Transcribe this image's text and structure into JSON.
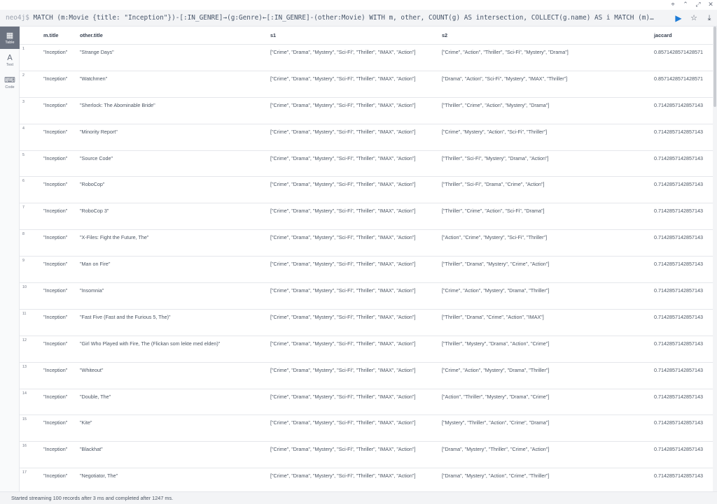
{
  "window_controls": [
    "⌖",
    "⌃",
    "⤢",
    "✕"
  ],
  "query": {
    "prompt": "neo4j$",
    "text": " MATCH (m:Movie {title: \"Inception\"})-[:IN_GENRE]→(g:Genre)←[:IN_GENRE]-(other:Movie) WITH m, other, COUNT(g) AS intersection, COLLECT(g.name) AS i MATCH (m)…",
    "run_icon": "▶",
    "favorite_icon": "☆",
    "download_icon": "⤓"
  },
  "sidebar": {
    "items": [
      {
        "label": "Table",
        "icon": "▦",
        "active": true
      },
      {
        "label": "Text",
        "icon": "A",
        "active": false
      },
      {
        "label": "Code",
        "icon": "⌨",
        "active": false
      }
    ]
  },
  "table": {
    "columns": [
      "m.title",
      "other.title",
      "s1",
      "s2",
      "jaccard"
    ],
    "rows": [
      {
        "n": "1",
        "mt": "\"Inception\"",
        "ot": "\"Strange Days\"",
        "s1": "[\"Crime\", \"Drama\", \"Mystery\", \"Sci-Fi\", \"Thriller\", \"IMAX\", \"Action\"]",
        "s2": "[\"Crime\", \"Action\", \"Thriller\", \"Sci-Fi\", \"Mystery\", \"Drama\"]",
        "j": "0.8571428571428571"
      },
      {
        "n": "2",
        "mt": "\"Inception\"",
        "ot": "\"Watchmen\"",
        "s1": "[\"Crime\", \"Drama\", \"Mystery\", \"Sci-Fi\", \"Thriller\", \"IMAX\", \"Action\"]",
        "s2": "[\"Drama\", \"Action\", \"Sci-Fi\", \"Mystery\", \"IMAX\", \"Thriller\"]",
        "j": "0.8571428571428571"
      },
      {
        "n": "3",
        "mt": "\"Inception\"",
        "ot": "\"Sherlock: The Abominable Bride\"",
        "s1": "[\"Crime\", \"Drama\", \"Mystery\", \"Sci-Fi\", \"Thriller\", \"IMAX\", \"Action\"]",
        "s2": "[\"Thriller\", \"Crime\", \"Action\", \"Mystery\", \"Drama\"]",
        "j": "0.7142857142857143"
      },
      {
        "n": "4",
        "mt": "\"Inception\"",
        "ot": "\"Minority Report\"",
        "s1": "[\"Crime\", \"Drama\", \"Mystery\", \"Sci-Fi\", \"Thriller\", \"IMAX\", \"Action\"]",
        "s2": "[\"Crime\", \"Mystery\", \"Action\", \"Sci-Fi\", \"Thriller\"]",
        "j": "0.7142857142857143"
      },
      {
        "n": "5",
        "mt": "\"Inception\"",
        "ot": "\"Source Code\"",
        "s1": "[\"Crime\", \"Drama\", \"Mystery\", \"Sci-Fi\", \"Thriller\", \"IMAX\", \"Action\"]",
        "s2": "[\"Thriller\", \"Sci-Fi\", \"Mystery\", \"Drama\", \"Action\"]",
        "j": "0.7142857142857143"
      },
      {
        "n": "6",
        "mt": "\"Inception\"",
        "ot": "\"RoboCop\"",
        "s1": "[\"Crime\", \"Drama\", \"Mystery\", \"Sci-Fi\", \"Thriller\", \"IMAX\", \"Action\"]",
        "s2": "[\"Thriller\", \"Sci-Fi\", \"Drama\", \"Crime\", \"Action\"]",
        "j": "0.7142857142857143"
      },
      {
        "n": "7",
        "mt": "\"Inception\"",
        "ot": "\"RoboCop 3\"",
        "s1": "[\"Crime\", \"Drama\", \"Mystery\", \"Sci-Fi\", \"Thriller\", \"IMAX\", \"Action\"]",
        "s2": "[\"Thriller\", \"Crime\", \"Action\", \"Sci-Fi\", \"Drama\"]",
        "j": "0.7142857142857143"
      },
      {
        "n": "8",
        "mt": "\"Inception\"",
        "ot": "\"X-Files: Fight the Future, The\"",
        "s1": "[\"Crime\", \"Drama\", \"Mystery\", \"Sci-Fi\", \"Thriller\", \"IMAX\", \"Action\"]",
        "s2": "[\"Action\", \"Crime\", \"Mystery\", \"Sci-Fi\", \"Thriller\"]",
        "j": "0.7142857142857143"
      },
      {
        "n": "9",
        "mt": "\"Inception\"",
        "ot": "\"Man on Fire\"",
        "s1": "[\"Crime\", \"Drama\", \"Mystery\", \"Sci-Fi\", \"Thriller\", \"IMAX\", \"Action\"]",
        "s2": "[\"Thriller\", \"Drama\", \"Mystery\", \"Crime\", \"Action\"]",
        "j": "0.7142857142857143"
      },
      {
        "n": "10",
        "mt": "\"Inception\"",
        "ot": "\"Insomnia\"",
        "s1": "[\"Crime\", \"Drama\", \"Mystery\", \"Sci-Fi\", \"Thriller\", \"IMAX\", \"Action\"]",
        "s2": "[\"Crime\", \"Action\", \"Mystery\", \"Drama\", \"Thriller\"]",
        "j": "0.7142857142857143"
      },
      {
        "n": "11",
        "mt": "\"Inception\"",
        "ot": "\"Fast Five (Fast and the Furious 5, The)\"",
        "s1": "[\"Crime\", \"Drama\", \"Mystery\", \"Sci-Fi\", \"Thriller\", \"IMAX\", \"Action\"]",
        "s2": "[\"Thriller\", \"Drama\", \"Crime\", \"Action\", \"IMAX\"]",
        "j": "0.7142857142857143"
      },
      {
        "n": "12",
        "mt": "\"Inception\"",
        "ot": "\"Girl Who Played with Fire, The (Flickan som lekte med elden)\"",
        "s1": "[\"Crime\", \"Drama\", \"Mystery\", \"Sci-Fi\", \"Thriller\", \"IMAX\", \"Action\"]",
        "s2": "[\"Thriller\", \"Mystery\", \"Drama\", \"Action\", \"Crime\"]",
        "j": "0.7142857142857143"
      },
      {
        "n": "13",
        "mt": "\"Inception\"",
        "ot": "\"Whiteout\"",
        "s1": "[\"Crime\", \"Drama\", \"Mystery\", \"Sci-Fi\", \"Thriller\", \"IMAX\", \"Action\"]",
        "s2": "[\"Crime\", \"Action\", \"Mystery\", \"Drama\", \"Thriller\"]",
        "j": "0.7142857142857143"
      },
      {
        "n": "14",
        "mt": "\"Inception\"",
        "ot": "\"Double, The\"",
        "s1": "[\"Crime\", \"Drama\", \"Mystery\", \"Sci-Fi\", \"Thriller\", \"IMAX\", \"Action\"]",
        "s2": "[\"Action\", \"Thriller\", \"Mystery\", \"Drama\", \"Crime\"]",
        "j": "0.7142857142857143"
      },
      {
        "n": "15",
        "mt": "\"Inception\"",
        "ot": "\"Kite\"",
        "s1": "[\"Crime\", \"Drama\", \"Mystery\", \"Sci-Fi\", \"Thriller\", \"IMAX\", \"Action\"]",
        "s2": "[\"Mystery\", \"Thriller\", \"Action\", \"Crime\", \"Drama\"]",
        "j": "0.7142857142857143"
      },
      {
        "n": "16",
        "mt": "\"Inception\"",
        "ot": "\"Blackhat\"",
        "s1": "[\"Crime\", \"Drama\", \"Mystery\", \"Sci-Fi\", \"Thriller\", \"IMAX\", \"Action\"]",
        "s2": "[\"Drama\", \"Mystery\", \"Thriller\", \"Crime\", \"Action\"]",
        "j": "0.7142857142857143"
      },
      {
        "n": "17",
        "mt": "\"Inception\"",
        "ot": "\"Negotiator, The\"",
        "s1": "[\"Crime\", \"Drama\", \"Mystery\", \"Sci-Fi\", \"Thriller\", \"IMAX\", \"Action\"]",
        "s2": "[\"Drama\", \"Mystery\", \"Action\", \"Crime\", \"Thriller\"]",
        "j": "0.7142857142857143"
      }
    ]
  },
  "status": "Started streaming 100 records after 3 ms and completed after 1247 ms."
}
